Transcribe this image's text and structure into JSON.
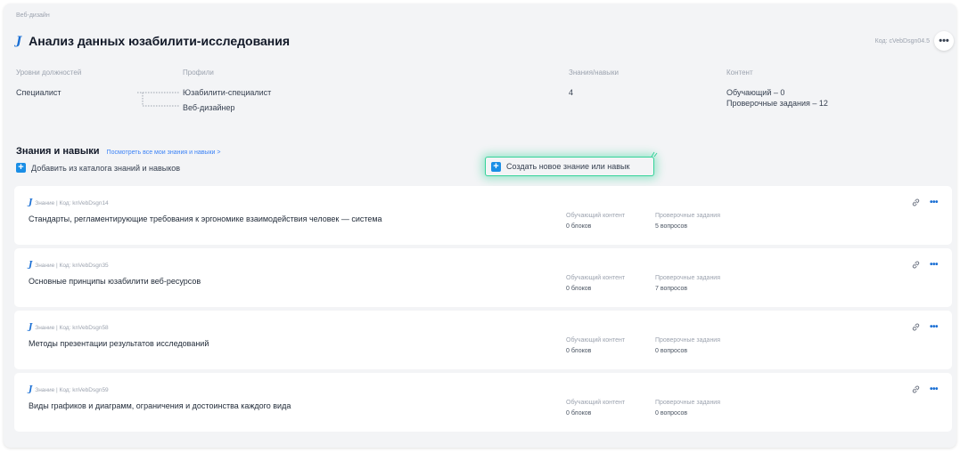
{
  "breadcrumb": "Веб-дизайн",
  "title": "Анализ данных юзабилити-исследования",
  "code": "Код: cVebDsgn04.5",
  "columns": {
    "levels": {
      "header": "Уровни должностей",
      "value": "Специалист"
    },
    "profiles": {
      "header": "Профили",
      "items": [
        "Юзабилити-специалист",
        "Веб-дизайнер"
      ]
    },
    "skills": {
      "header": "Знания/навыки",
      "value": "4"
    },
    "content": {
      "header": "Контент",
      "items": [
        "Обучающий – 0",
        "Проверочные задания – 12"
      ]
    }
  },
  "section": {
    "title": "Знания и навыки",
    "link": "Посмотреть все мои знания и навыки >",
    "add_catalog": "Добавить из каталога знаний и навыков",
    "create_new": "Создать новое знание или навык"
  },
  "stat_labels": {
    "learning": "Обучающий контент",
    "tests": "Проверочные задания"
  },
  "items": [
    {
      "meta": "Знание | Код: knVebDsgn14",
      "title": "Стандарты, регламентирующие требования к эргономике взаимодействия человек — система",
      "learning": "0 блоков",
      "tests": "5 вопросов"
    },
    {
      "meta": "Знание | Код: knVebDsgn35",
      "title": "Основные принципы юзабилити веб-ресурсов",
      "learning": "0 блоков",
      "tests": "7 вопросов"
    },
    {
      "meta": "Знание | Код: knVebDsgn58",
      "title": "Методы презентации результатов исследований",
      "learning": "0 блоков",
      "tests": "0 вопросов"
    },
    {
      "meta": "Знание | Код: knVebDsgn59",
      "title": "Виды графиков и диаграмм, ограничения и достоинства каждого вида",
      "learning": "0 блоков",
      "tests": "0 вопросов"
    }
  ],
  "icons": {
    "logo": "j-logo-icon",
    "add": "plus-icon",
    "link": "link-icon",
    "more": "more-dots-icon"
  },
  "colors": {
    "accent": "#1a6fd4",
    "plus": "#1a8ee6",
    "highlight": "#34d399",
    "panel": "#f3f4f6"
  }
}
